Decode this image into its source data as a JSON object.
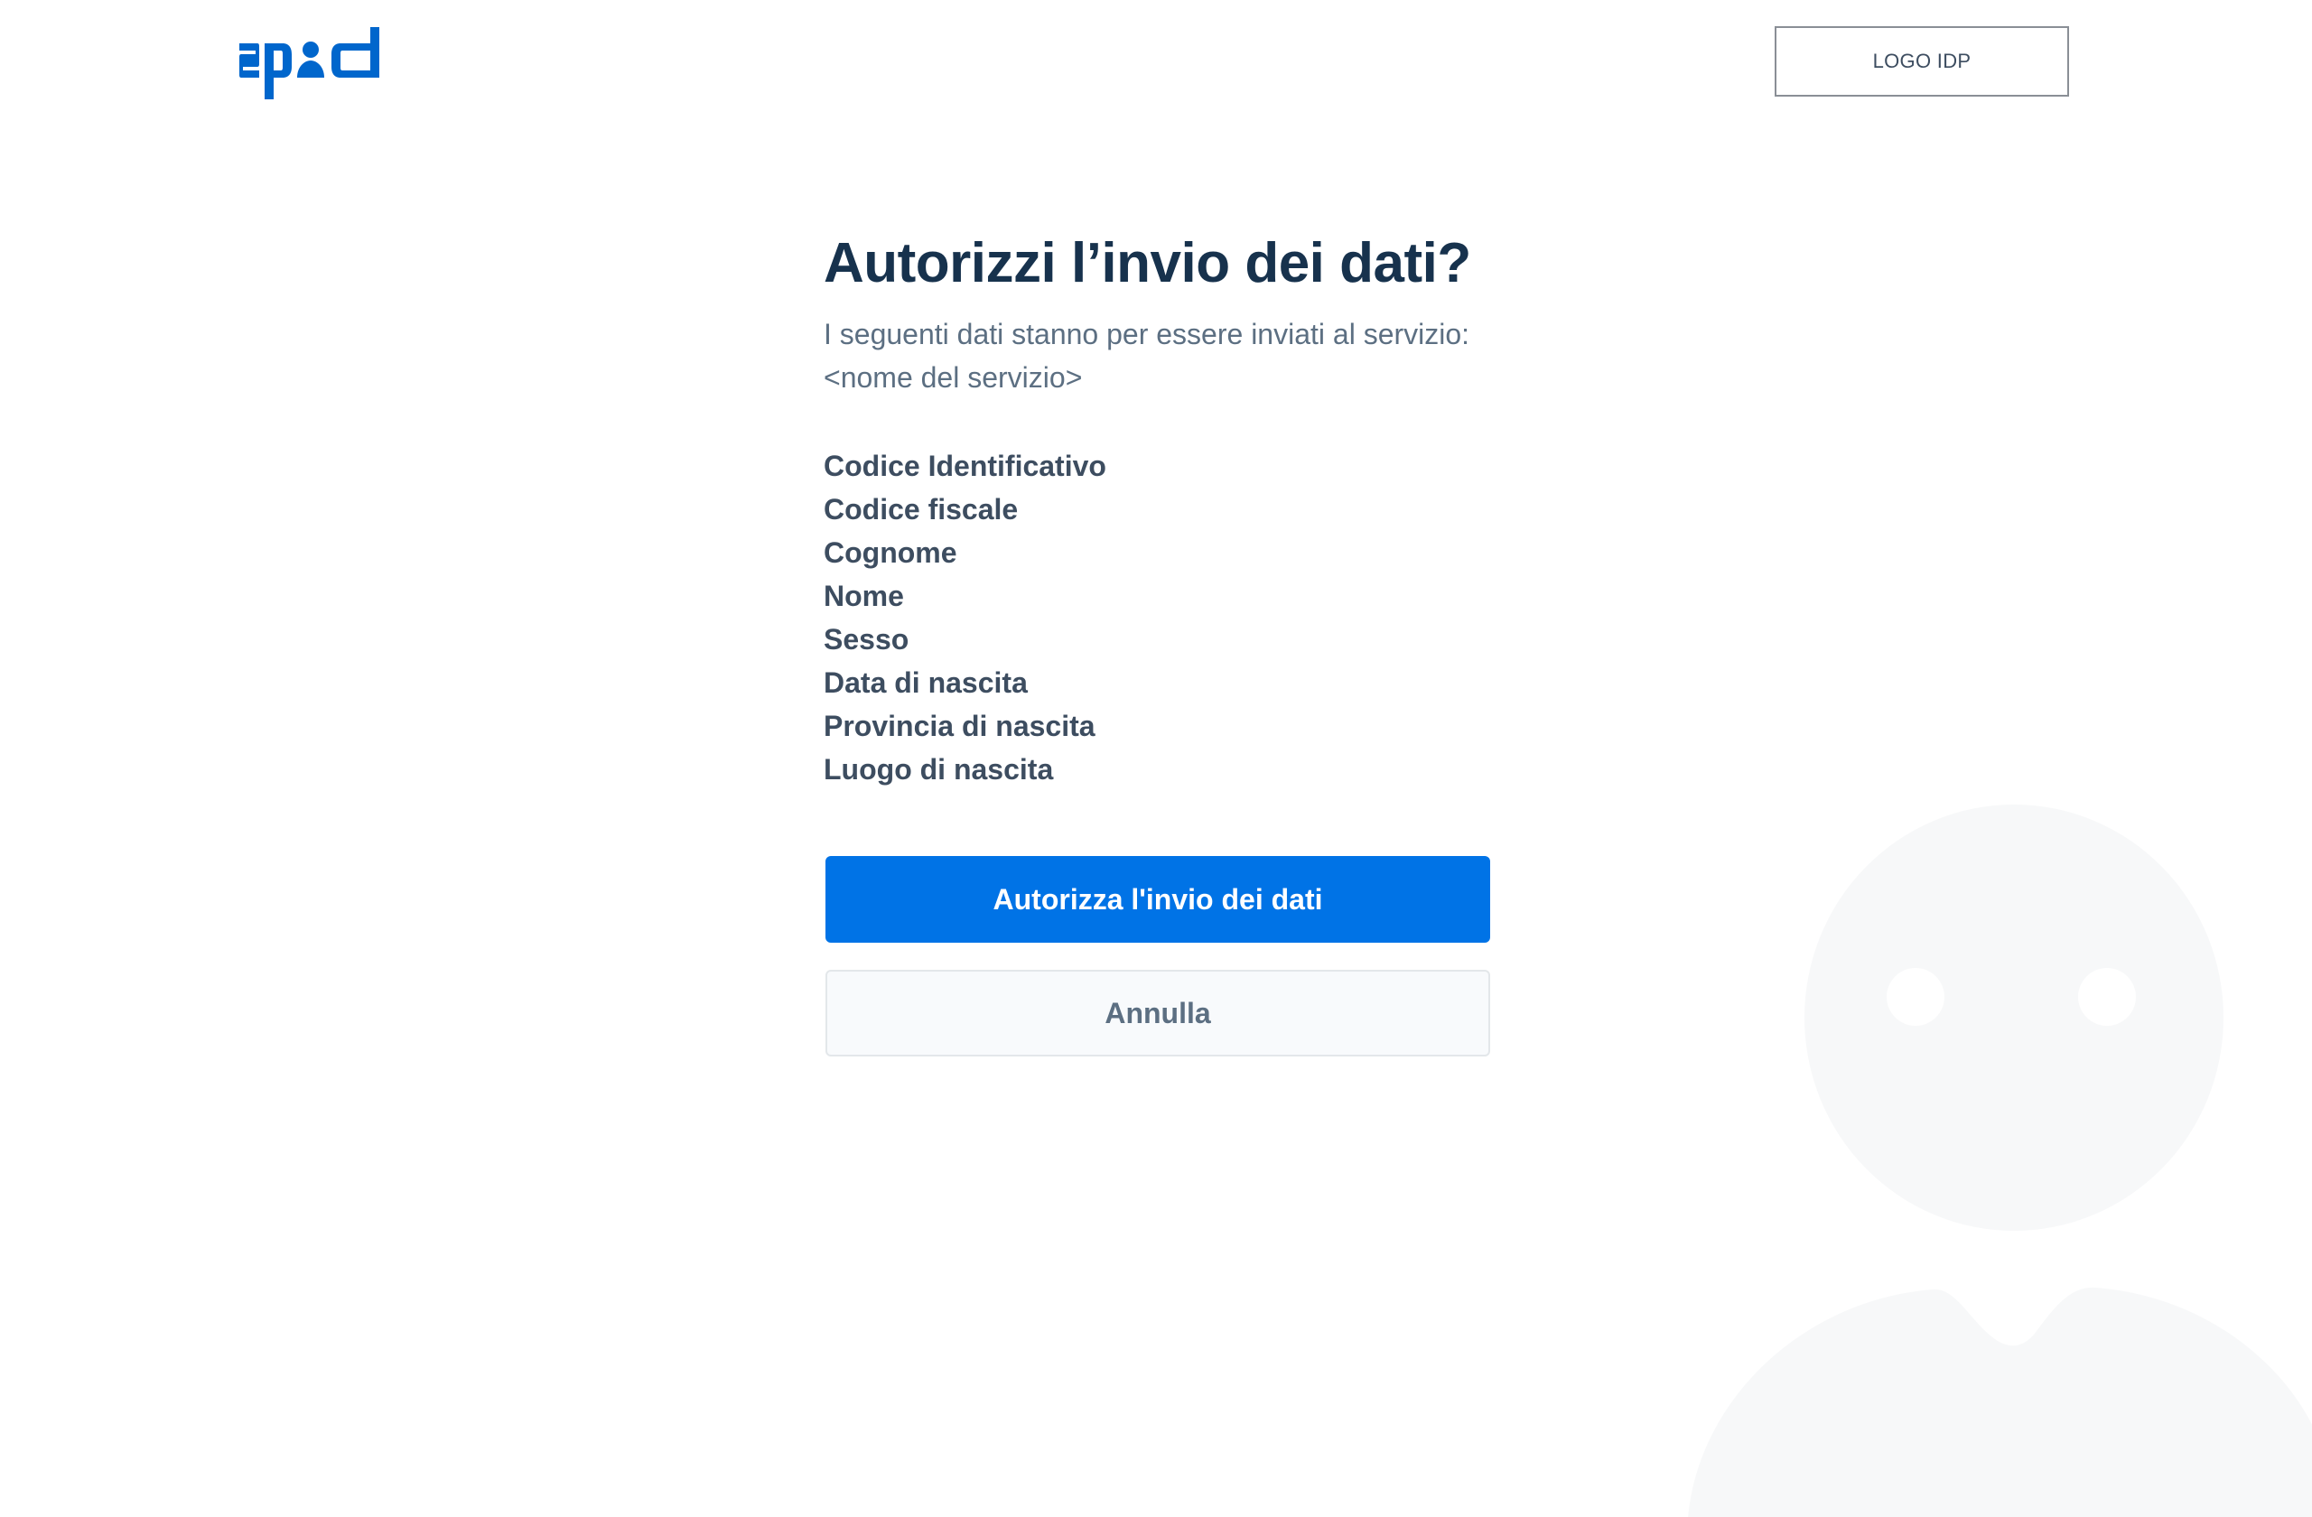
{
  "header": {
    "brand_logo_alt": "spid",
    "idp_logo_label": "LOGO IDP"
  },
  "main": {
    "title": "Autorizzi l’invio dei dati?",
    "subtitle_line1": "I seguenti dati stanno per essere inviati al servizio:",
    "service_name": "<nome del servizio>",
    "attributes": [
      "Codice Identificativo",
      "Codice fiscale",
      "Cognome",
      "Nome",
      "Sesso",
      "Data di nascita",
      "Provincia di nascita",
      "Luogo di nascita"
    ],
    "authorize_button_label": "Autorizza l'invio dei dati",
    "cancel_button_label": "Annulla"
  },
  "colors": {
    "brand_blue": "#0066cc",
    "primary_button": "#0073e6",
    "title_text": "#17324d",
    "body_text": "#5c6f82",
    "list_text": "#3d4d60",
    "mascot_fill": "#f7f8f9"
  },
  "icons": {
    "brand": "spid-logo",
    "background": "spid-mascot-illustration"
  }
}
